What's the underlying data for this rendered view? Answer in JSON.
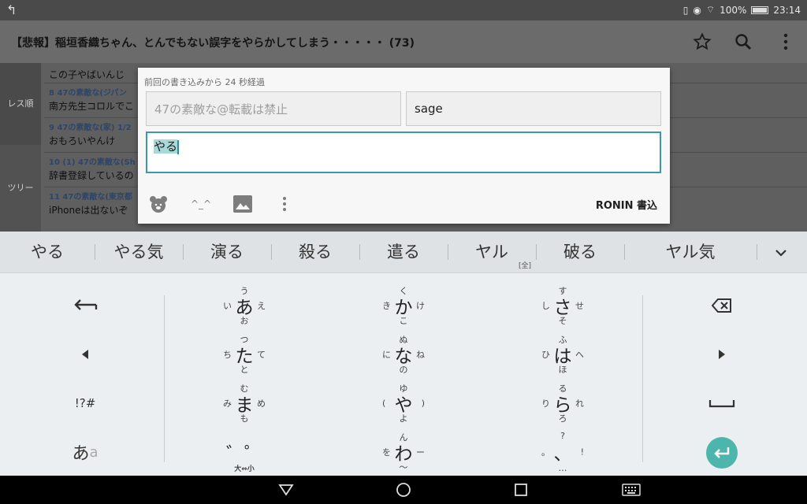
{
  "status": {
    "battery": "100%",
    "time": "23:14"
  },
  "appbar": {
    "title": "【悲報】稲垣香織ちゃん、とんでもない誤字をやらかしてしまう・・・・・ (73)"
  },
  "sidebar": {
    "item1": "レス順",
    "item2": "ツリー"
  },
  "posts": [
    {
      "header": "",
      "body": "この子やばいんじ"
    },
    {
      "header": "8  47の素敵な(ジパン",
      "body": "南方先生コロルでこ"
    },
    {
      "header": "9  47の素敵な(家) 1/2",
      "body": "おもろいやんけ"
    },
    {
      "header": "10 (1)  47の素敵な(Sh",
      "body": "辞書登録しているの"
    },
    {
      "header": "11  47の素敵な(東京都",
      "body": "iPhoneは出ないぞ"
    }
  ],
  "dialog": {
    "elapsed": "前回の書き込みから 24 秒経過",
    "name_placeholder": "47の素敵な@転載は禁止",
    "mail_value": "sage",
    "message_value": "やる",
    "submit_label": "RONIN 書込",
    "kaomoji_label": "^_^"
  },
  "candidates": [
    "やる",
    "やる気",
    "演る",
    "殺る",
    "遣る",
    "ヤル",
    "破る",
    "ヤル気"
  ],
  "candidate_full_hint": "[全]",
  "keyboard": {
    "rows": [
      [
        {
          "main": "あ",
          "t": "う",
          "l": "い",
          "r": "え",
          "b": "お"
        },
        {
          "main": "か",
          "t": "く",
          "l": "き",
          "r": "け",
          "b": "こ"
        },
        {
          "main": "さ",
          "t": "す",
          "l": "し",
          "r": "せ",
          "b": "そ"
        }
      ],
      [
        {
          "main": "た",
          "t": "つ",
          "l": "ち",
          "r": "て",
          "b": "と"
        },
        {
          "main": "な",
          "t": "ぬ",
          "l": "に",
          "r": "ね",
          "b": "の"
        },
        {
          "main": "は",
          "t": "ふ",
          "l": "ひ",
          "r": "へ",
          "b": "ほ"
        }
      ],
      [
        {
          "main": "ま",
          "t": "む",
          "l": "み",
          "r": "め",
          "b": "も"
        },
        {
          "main": "や",
          "t": "ゆ",
          "l": "(",
          "r": ")",
          "b": "よ"
        },
        {
          "main": "ら",
          "t": "る",
          "l": "り",
          "r": "れ",
          "b": "ろ"
        }
      ],
      [
        {
          "main": "゛゜",
          "t": "",
          "l": "",
          "r": "",
          "b": "大⇔小"
        },
        {
          "main": "わ",
          "t": "ん",
          "l": "を",
          "r": "ー",
          "b": "～"
        },
        {
          "main": "、",
          "t": "?",
          "l": "。",
          "r": "!",
          "b": "…"
        }
      ]
    ],
    "symbol_key": "!?#",
    "mode_key_main": "あ",
    "mode_key_sub": "a"
  },
  "colors": {
    "accent": "#4db6ac",
    "dialog_focus": "#3a9aa6"
  }
}
